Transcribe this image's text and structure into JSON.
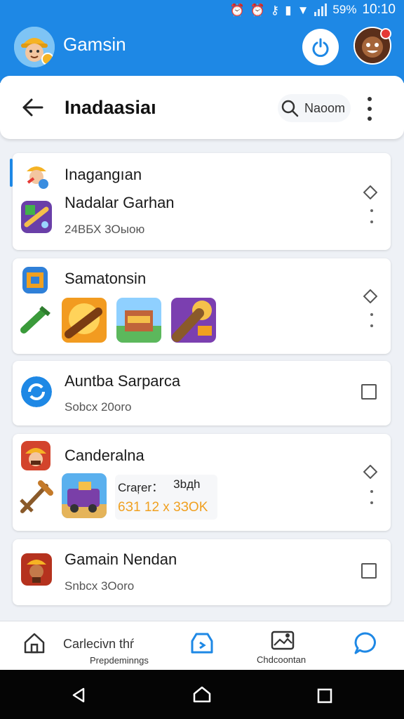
{
  "status_bar": {
    "battery": "59%",
    "time": "10:10",
    "icons": [
      "alarm-icon",
      "alarm-icon",
      "vpn-key-icon",
      "battery-saver-icon",
      "wifi-icon",
      "signal-icon"
    ]
  },
  "app_bar": {
    "title": "Gamsin",
    "icons": [
      "app-avatar-icon",
      "power-icon",
      "user-avatar-icon"
    ]
  },
  "header": {
    "title": "Inadaasiaı",
    "search_label": "Naoom",
    "icons": [
      "back-arrow-icon",
      "search-icon",
      "more-vert-icon"
    ]
  },
  "items": [
    {
      "title": "Inagangıan",
      "subtitle": "Nadalar Garhan",
      "meta": "24ВБХ 3Оыою",
      "accent": "#1e88e5"
    },
    {
      "title": "Samatonsin"
    },
    {
      "title": "Auntba Sarparca",
      "meta": "Sobcx 20oro"
    },
    {
      "title": "Canderalna",
      "price_label": "Craŗer：",
      "price_value": "3bдh",
      "price_detail": "6З1 12 x 3ЗОK",
      "price_color": "#f0a020"
    },
    {
      "title": "Gamain Nendan",
      "meta": "Snbcx 3Ooro"
    }
  ],
  "bottom_nav": {
    "items": [
      {
        "label": "",
        "icon": "home-icon"
      },
      {
        "label": "Carlecivn thŕ",
        "sublabel": "Prepdeminngs",
        "icon": "scroll-icon"
      },
      {
        "label": "",
        "icon": "store-icon",
        "active": true
      },
      {
        "label": "Chdcoontan",
        "icon": "gallery-icon"
      },
      {
        "label": "",
        "icon": "chat-bubble-icon",
        "active": true
      }
    ]
  },
  "system_nav": {
    "icons": [
      "back-triangle-icon",
      "home-house-icon",
      "recents-square-icon"
    ]
  },
  "colors": {
    "primary": "#1e88e5",
    "accent_orange": "#f0a020",
    "background": "#eef1f6"
  }
}
